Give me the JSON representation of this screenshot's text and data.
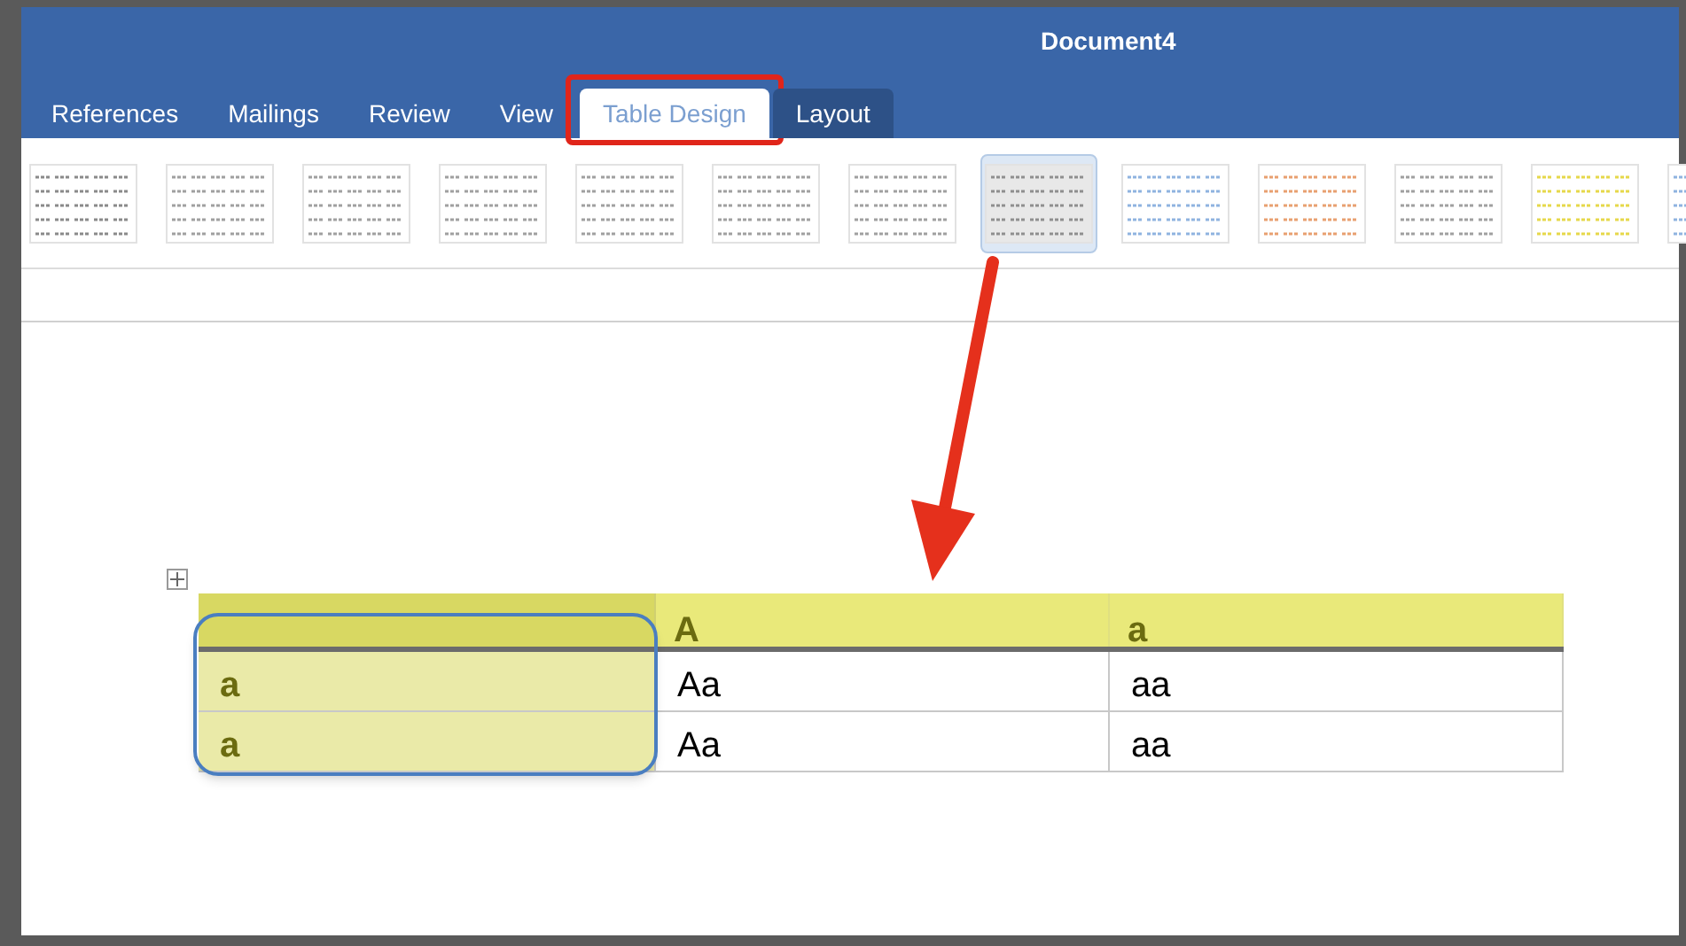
{
  "window": {
    "title": "Document4"
  },
  "tabs": [
    {
      "label": "References",
      "selected": false,
      "kind": "normal"
    },
    {
      "label": "Mailings",
      "selected": false,
      "kind": "normal"
    },
    {
      "label": "Review",
      "selected": false,
      "kind": "normal"
    },
    {
      "label": "View",
      "selected": false,
      "kind": "normal"
    },
    {
      "label": "Table Design",
      "selected": true,
      "kind": "contextual"
    },
    {
      "label": "Layout",
      "selected": false,
      "kind": "contextual"
    }
  ],
  "table_styles": [
    {
      "selected": false,
      "color": "#8a8a8a"
    },
    {
      "selected": false,
      "color": "#a0a0a0"
    },
    {
      "selected": false,
      "color": "#a0a0a0"
    },
    {
      "selected": false,
      "color": "#a0a0a0"
    },
    {
      "selected": false,
      "color": "#a0a0a0"
    },
    {
      "selected": false,
      "color": "#a0a0a0"
    },
    {
      "selected": false,
      "color": "#a0a0a0"
    },
    {
      "selected": true,
      "color": "#8f8f8f"
    },
    {
      "selected": false,
      "color": "#8fb3e0"
    },
    {
      "selected": false,
      "color": "#e8a070"
    },
    {
      "selected": false,
      "color": "#a0a0a0"
    },
    {
      "selected": false,
      "color": "#e6d84a"
    },
    {
      "selected": false,
      "color": "#8fb3e0"
    }
  ],
  "table": {
    "header": [
      "A",
      "a"
    ],
    "rows": [
      [
        "a",
        "Aa",
        "aa"
      ],
      [
        "a",
        "Aa",
        "aa"
      ]
    ]
  }
}
